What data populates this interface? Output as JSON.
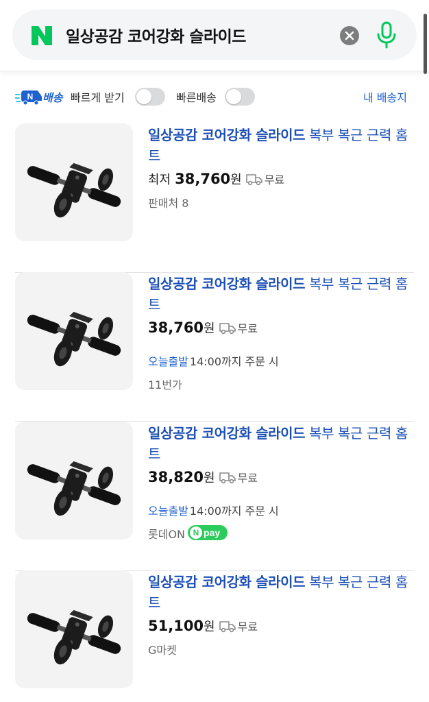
{
  "search": {
    "query": "일상공감 코어강화 슬라이드",
    "logo": "N"
  },
  "filters": {
    "nship_badge": "N",
    "nship_label": "배송",
    "fast_label": "빠르게 받기",
    "quick_label": "빠른배송",
    "fast_toggle_on": false,
    "quick_toggle_on": false,
    "my_destination": "내 배송지"
  },
  "products": [
    {
      "title_bold": "일상공감 코어강화 슬라이드",
      "title_rest": " 복부 복근 근력 홈트",
      "price_prefix": "최저",
      "price": "38,760",
      "currency": "원",
      "shipping": "무료",
      "today_ship": "",
      "cutoff": "",
      "seller": "판매처 8",
      "npay": ""
    },
    {
      "title_bold": "일상공감 코어강화 슬라이드",
      "title_rest": " 복부 복근 근력 홈트",
      "price_prefix": "",
      "price": "38,760",
      "currency": "원",
      "shipping": "무료",
      "today_ship": "오늘출발",
      "cutoff": "14:00까지 주문 시",
      "seller": "11번가",
      "npay": ""
    },
    {
      "title_bold": "일상공감 코어강화 슬라이드",
      "title_rest": " 복부 복근 근력 홈트",
      "price_prefix": "",
      "price": "38,820",
      "currency": "원",
      "shipping": "무료",
      "today_ship": "오늘출발",
      "cutoff": "14:00까지 주문 시",
      "seller": "롯데ON",
      "npay": "pay"
    },
    {
      "title_bold": "일상공감 코어강화 슬라이드",
      "title_rest": " 복부 복근 근력 홈트",
      "price_prefix": "",
      "price": "51,100",
      "currency": "원",
      "shipping": "무료",
      "today_ship": "",
      "cutoff": "",
      "seller": "G마켓",
      "npay": ""
    }
  ],
  "npay_letter": "N",
  "colors": {
    "naver_green": "#03c75a",
    "link_blue": "#1e62d0",
    "npay_green": "#2bcc5c"
  }
}
